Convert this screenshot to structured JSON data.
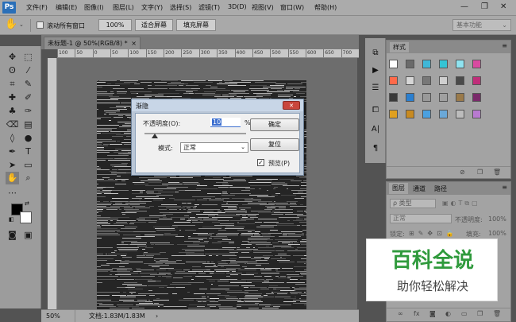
{
  "app": {
    "logo": "Ps"
  },
  "menu": {
    "items": [
      "文件(F)",
      "编辑(E)",
      "图像(I)",
      "图层(L)",
      "文字(Y)",
      "选择(S)",
      "滤镜(T)",
      "3D(D)",
      "视图(V)",
      "窗口(W)",
      "帮助(H)"
    ],
    "window_buttons": {
      "minimize": "—",
      "restore": "❐",
      "close": "✕"
    }
  },
  "options_bar": {
    "tool_icon": "hand-icon",
    "scroll_all_label": "滚动所有窗口",
    "zoom_value": "100%",
    "fit_screen_label": "适合屏幕",
    "fill_screen_label": "填充屏幕",
    "workspace_label": "基本功能"
  },
  "document": {
    "tab_title": "未标题-1 @ 50%(RGB/8) *",
    "ruler_labels": [
      "100",
      "50",
      "0",
      "50",
      "100",
      "150",
      "200",
      "250",
      "300",
      "350",
      "400",
      "450",
      "500",
      "550",
      "600",
      "650",
      "700"
    ],
    "status_zoom": "50%",
    "status_doc": "文档:1.83M/1.83M"
  },
  "dialog": {
    "title": "渐隐",
    "opacity_label": "不透明度(O):",
    "opacity_value": "10",
    "opacity_unit": "%",
    "opacity_level": 0.1,
    "mode_label": "模式:",
    "mode_value": "正常",
    "ok_label": "确定",
    "reset_label": "复位",
    "preview_label": "预览(P)",
    "preview_checked": true
  },
  "styles_panel": {
    "title": "样式"
  },
  "layers_panel": {
    "tabs": [
      "图层",
      "通道",
      "路径"
    ],
    "kind_label": "ρ 类型",
    "blend_mode": "正常",
    "opacity_label": "不透明度:",
    "opacity_value": "100%",
    "lock_label": "锁定:",
    "fill_label": "填充:",
    "fill_value": "100%"
  },
  "watermark": {
    "title": "百科全说",
    "subtitle": "助你轻松解决"
  },
  "colors": {
    "accent": "#2a6fb8",
    "watermark_green": "#2f9a3c",
    "dialog_frame": "#b9c6d6"
  }
}
